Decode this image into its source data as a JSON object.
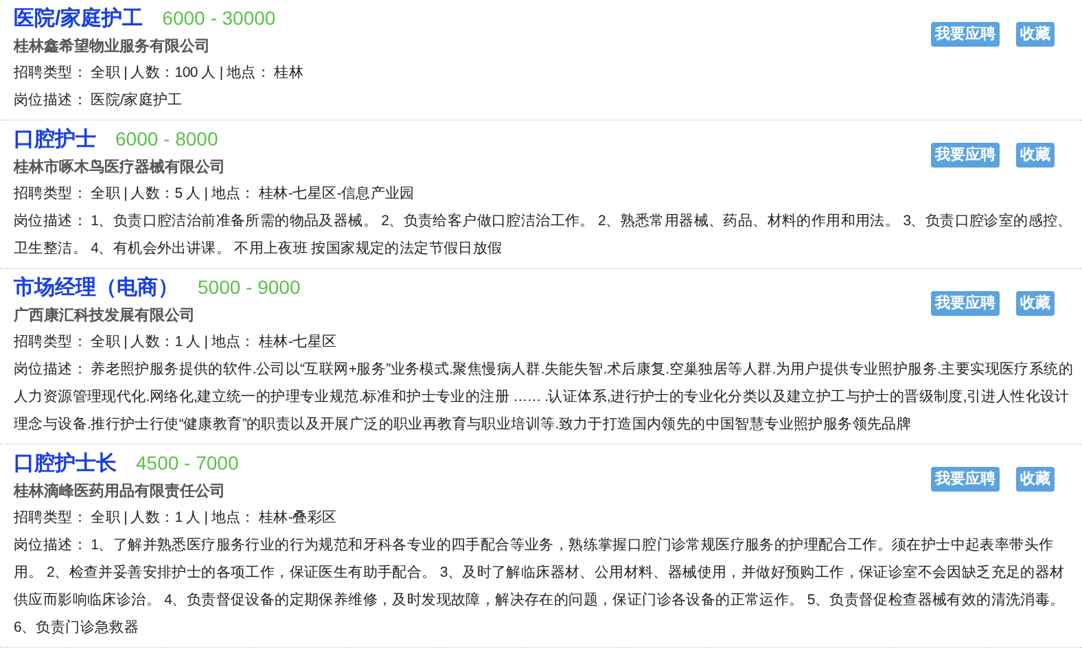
{
  "jobs": [
    {
      "title": "医院/家庭护工",
      "salary": "6000 - 30000",
      "company": "桂林鑫希望物业服务有限公司",
      "info": "招聘类型： 全职 | 人数：100 人 | 地点： 桂林",
      "description": "岗位描述： 医院/家庭护工",
      "buttons": [
        "我要应聘",
        "收藏"
      ]
    },
    {
      "title": "口腔护士",
      "salary": "6000 - 8000",
      "company": "桂林市啄木鸟医疗器械有限公司",
      "info": "招聘类型： 全职 | 人数：5 人 | 地点： 桂林-七星区-信息产业园",
      "description": "岗位描述： 1、负责口腔洁治前准备所需的物品及器械。 2、负责给客户做口腔洁治工作。 2、熟悉常用器械、药品、材料的作用和用法。 3、负责口腔诊室的感控、卫生整洁。 4、有机会外出讲课。 不用上夜班 按国家规定的法定节假日放假",
      "buttons": [
        "我要应聘",
        "收藏"
      ]
    },
    {
      "title": "市场经理（电商）",
      "salary": "5000 - 9000",
      "company": "广西康汇科技发展有限公司",
      "info": "招聘类型： 全职 | 人数：1 人 | 地点： 桂林-七星区",
      "description": "岗位描述： 养老照护服务提供的软件.公司以“互联网+服务”业务模式.聚焦慢病人群.失能失智.术后康复.空巢独居等人群.为用户提供专业照护服务.主要实现医疗系统的人力资源管理现代化.网络化,建立统一的护理专业规范.标准和护士专业的注册 …… .认证体系,进行护士的专业化分类以及建立护工与护士的晋级制度,引进人性化设计理念与设备.推行护士行使“健康教育”的职责以及开展广泛的职业再教育与职业培训等.致力于打造国内领先的中国智慧专业照护服务领先品牌",
      "buttons": [
        "我要应聘",
        "收藏"
      ]
    },
    {
      "title": "口腔护士长",
      "salary": "4500 - 7000",
      "company": "桂林滴峰医药用品有限责任公司",
      "info": "招聘类型： 全职 | 人数：1 人 | 地点： 桂林-叠彩区",
      "description": "岗位描述： 1、了解并熟悉医疗服务行业的行为规范和牙科各专业的四手配合等业务，熟练掌握口腔门诊常规医疗服务的护理配合工作。须在护士中起表率带头作用。 2、检查并妥善安排护士的各项工作，保证医生有助手配合。 3、及时了解临床器材、公用材料、器械使用，并做好预购工作，保证诊室不会因缺乏充足的器材供应而影响临床诊治。 4、负责督促设备的定期保养维修，及时发现故障，解决存在的问题，保证门诊各设备的正常运作。 5、负责督促检查器械有效的清洗消毒。 6、负责门诊急救器",
      "buttons": [
        "我要应聘",
        "收藏"
      ]
    }
  ]
}
